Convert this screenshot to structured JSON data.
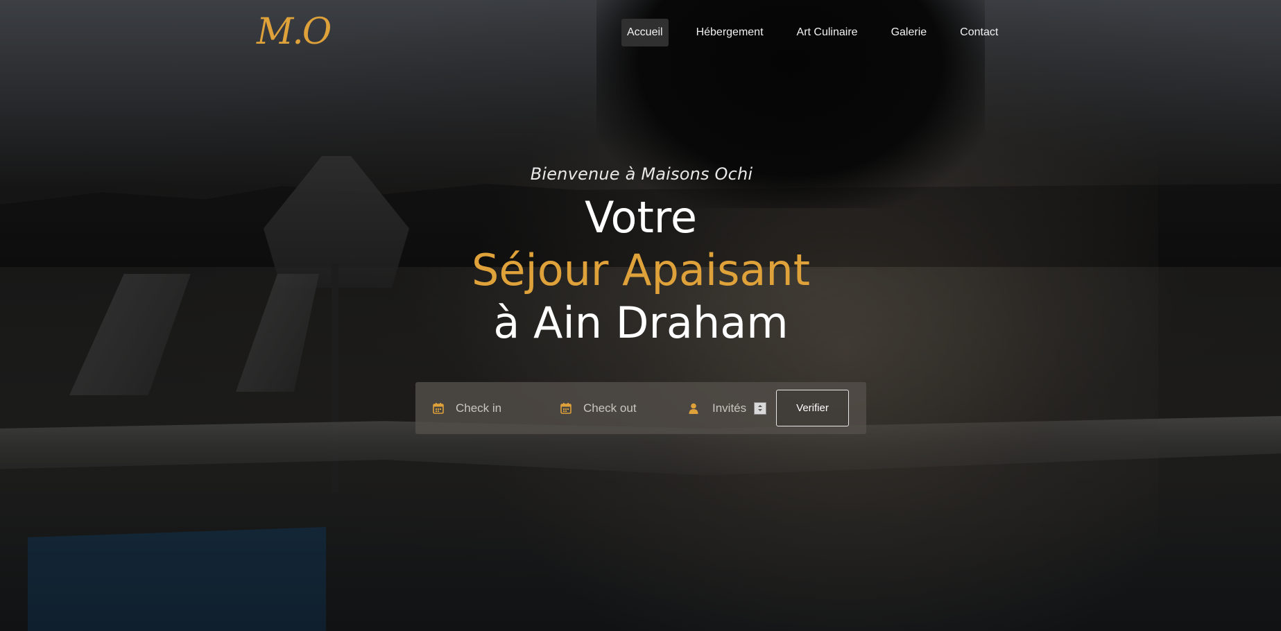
{
  "brand": {
    "logo_text": "M.O",
    "accent_color": "#dfa13a"
  },
  "nav": {
    "items": [
      {
        "label": "Accueil",
        "active": true
      },
      {
        "label": "Hébergement",
        "active": false
      },
      {
        "label": "Art Culinaire",
        "active": false
      },
      {
        "label": "Galerie",
        "active": false
      },
      {
        "label": "Contact",
        "active": false
      }
    ]
  },
  "hero": {
    "kicker": "Bienvenue à Maisons Ochi",
    "line1": "Votre",
    "line2": "Séjour Apaisant",
    "line3": "à Ain Draham"
  },
  "booking": {
    "checkin_placeholder": "Check in",
    "checkout_placeholder": "Check out",
    "guests_placeholder": "Invités",
    "submit_label": "Verifier",
    "icons": {
      "checkin": "calendar-icon",
      "checkout": "calendar-icon",
      "guests": "user-icon"
    }
  }
}
